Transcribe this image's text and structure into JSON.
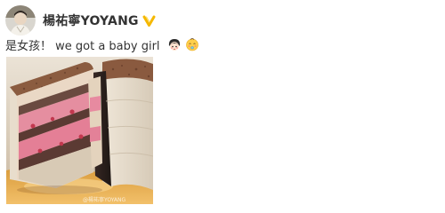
{
  "post": {
    "author_name": "楊祐寧YOYANG",
    "text": "是女孩！ we got a baby girl",
    "avatar_icon": "avatar",
    "verified_icon": "verified-badge-icon",
    "emoji_icons": [
      "baby-girl-emoji",
      "baby-face-emoji"
    ],
    "photo_watermark": "@楊祐寧YOYANG",
    "colors": {
      "author": "#333333",
      "text": "#333333",
      "verified": "#f5b800"
    }
  }
}
